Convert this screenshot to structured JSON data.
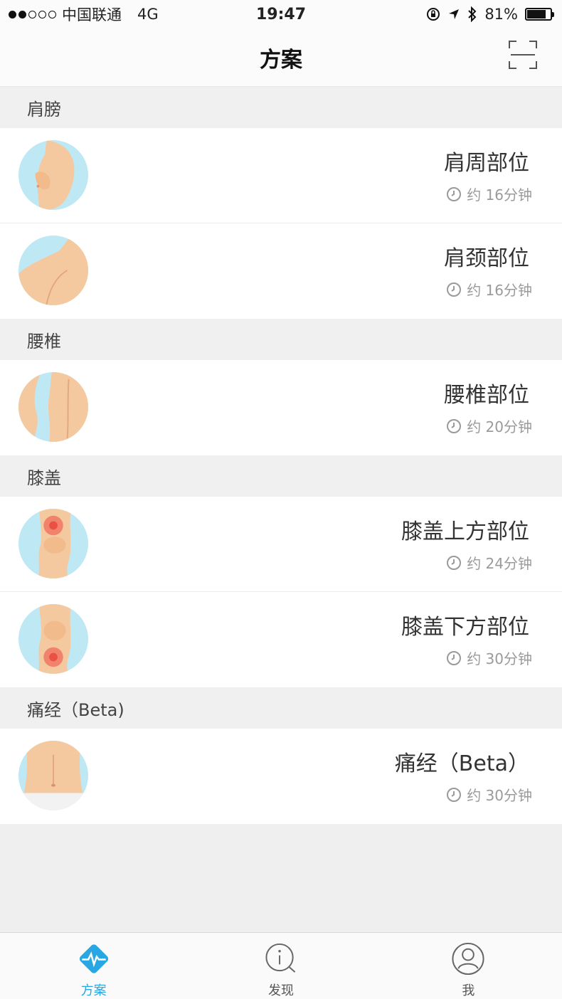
{
  "status_bar": {
    "carrier": "中国联通",
    "network": "4G",
    "time": "19:47",
    "battery": "81%",
    "battery_level": 0.81
  },
  "nav": {
    "title": "方案",
    "scan_icon": "scan-icon"
  },
  "sections": [
    {
      "title": "肩膀",
      "items": [
        {
          "title": "肩周部位",
          "duration": "约 16分钟",
          "image": "shoulder-front-illustration"
        },
        {
          "title": "肩颈部位",
          "duration": "约 16分钟",
          "image": "shoulder-back-illustration"
        }
      ]
    },
    {
      "title": "腰椎",
      "items": [
        {
          "title": "腰椎部位",
          "duration": "约 20分钟",
          "image": "lumbar-illustration"
        }
      ]
    },
    {
      "title": "膝盖",
      "items": [
        {
          "title": "膝盖上方部位",
          "duration": "约 24分钟",
          "image": "knee-upper-illustration"
        },
        {
          "title": "膝盖下方部位",
          "duration": "约 30分钟",
          "image": "knee-lower-illustration"
        }
      ]
    },
    {
      "title": "痛经（Beta)",
      "items": [
        {
          "title": "痛经（Beta）",
          "duration": "约 30分钟",
          "image": "abdomen-illustration"
        }
      ]
    }
  ],
  "tabs": [
    {
      "label": "方案",
      "icon": "heartbeat-diamond-icon",
      "active": true
    },
    {
      "label": "发现",
      "icon": "info-search-icon",
      "active": false
    },
    {
      "label": "我",
      "icon": "user-profile-icon",
      "active": false
    }
  ],
  "colors": {
    "accent": "#29a7e3",
    "skin": "#f4c9a0",
    "thumb_bg": "#bfe8f5",
    "pain_spot": "#f06a5a"
  }
}
